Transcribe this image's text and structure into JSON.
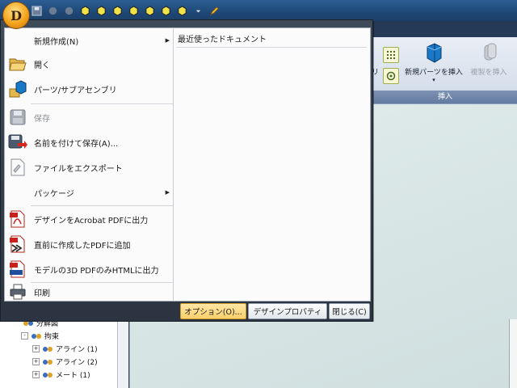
{
  "app": {
    "logo_letter": "D"
  },
  "quick_access": [
    "save-icon",
    "undo-icon",
    "redo-icon",
    "cube-view-1-icon",
    "cube-view-2-icon",
    "cube-view-3-icon",
    "cube-view-4-icon",
    "cube-view-5-icon",
    "cube-view-6-icon",
    "cube-view-7-icon",
    "dropdown-icon",
    "pencil-icon"
  ],
  "ribbon": {
    "partial_label": "リ",
    "new_part_insert": "新規パーツを挿入",
    "duplicate_insert": "複製を挿入",
    "group_label": "挿入"
  },
  "menu": {
    "items": [
      {
        "label": "新規作成(N)",
        "icon": "new-icon",
        "submenu": true,
        "disabled": false
      },
      {
        "label": "開く",
        "icon": "open-folder-icon",
        "submenu": false,
        "disabled": false
      },
      {
        "label": "パーツ/サブアセンブリ",
        "icon": "part-assembly-icon",
        "submenu": false,
        "disabled": false
      },
      {
        "label": "保存",
        "icon": "save-icon",
        "submenu": false,
        "disabled": true
      },
      {
        "label": "名前を付けて保存(A)...",
        "icon": "save-as-icon",
        "submenu": false,
        "disabled": false
      },
      {
        "label": "ファイルをエクスポート",
        "icon": "export-icon",
        "submenu": false,
        "disabled": false
      },
      {
        "label": "パッケージ",
        "icon": "package-icon",
        "submenu": true,
        "disabled": false
      },
      {
        "label": "デザインをAcrobat PDFに出力",
        "icon": "pdf-icon",
        "submenu": false,
        "disabled": false
      },
      {
        "label": "直前に作成したPDFに追加",
        "icon": "pdf-append-icon",
        "submenu": false,
        "disabled": false
      },
      {
        "label": "モデルの3D PDFのみHTMLに出力",
        "icon": "pdf-html-icon",
        "submenu": false,
        "disabled": false
      },
      {
        "label": "印刷",
        "icon": "printer-icon",
        "submenu": false,
        "disabled": false
      }
    ],
    "recent_title": "最近使ったドキュメント",
    "footer": {
      "options": "オプション(O)...",
      "design_properties": "デザインプロパティ",
      "close": "閉じる(C)"
    }
  },
  "tree": {
    "rows": [
      {
        "label": "分解図",
        "expand": ""
      },
      {
        "label": "拘束",
        "expand": "-"
      },
      {
        "label": "アライン (1)",
        "expand": "+"
      },
      {
        "label": "アライン (2)",
        "expand": "+"
      },
      {
        "label": "メート (1)",
        "expand": "+"
      }
    ]
  },
  "colors": {
    "menu_frame": "#2f3843",
    "footer_active": "#fbd06a",
    "ribbon_group": "#637ba0"
  }
}
